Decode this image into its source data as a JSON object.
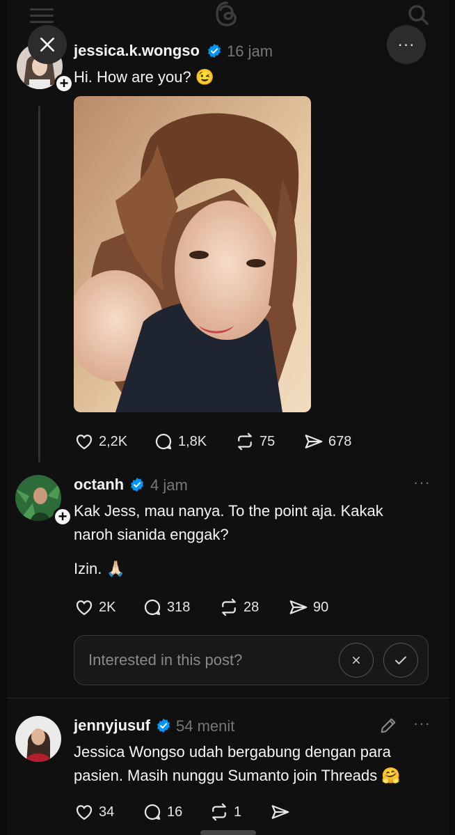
{
  "posts": [
    {
      "username": "jessica.k.wongso",
      "time": "16 jam",
      "text": "Hi. How are you? 😉",
      "likes": "2,2K",
      "replies": "1,8K",
      "reposts": "75",
      "shares": "678"
    },
    {
      "username": "octanh",
      "time": "4 jam",
      "text_line1": "Kak Jess, mau nanya. To the point aja. Kakak",
      "text_line2": "naroh sianida enggak?",
      "text_line3": "Izin. 🙏🏻",
      "likes": "2K",
      "replies": "318",
      "reposts": "28",
      "shares": "90"
    },
    {
      "username": "jennyjusuf",
      "time": "54 menit",
      "text_line1": "Jessica Wongso udah bergabung dengan para",
      "text_line2": "pasien. Masih nunggu Sumanto join Threads 🤗",
      "likes": "34",
      "replies": "16",
      "reposts": "1"
    }
  ],
  "interest_prompt": "Interested in this post?",
  "more_label": "···",
  "colors": {
    "background": "#101010",
    "verified": "#0095f6",
    "muted": "#777777"
  },
  "icons": [
    "menu-icon",
    "threads-logo-icon",
    "search-icon",
    "close-icon",
    "more-icon",
    "verified-icon",
    "heart-icon",
    "comment-icon",
    "repost-icon",
    "share-icon",
    "edit-icon",
    "x-icon",
    "check-icon"
  ]
}
